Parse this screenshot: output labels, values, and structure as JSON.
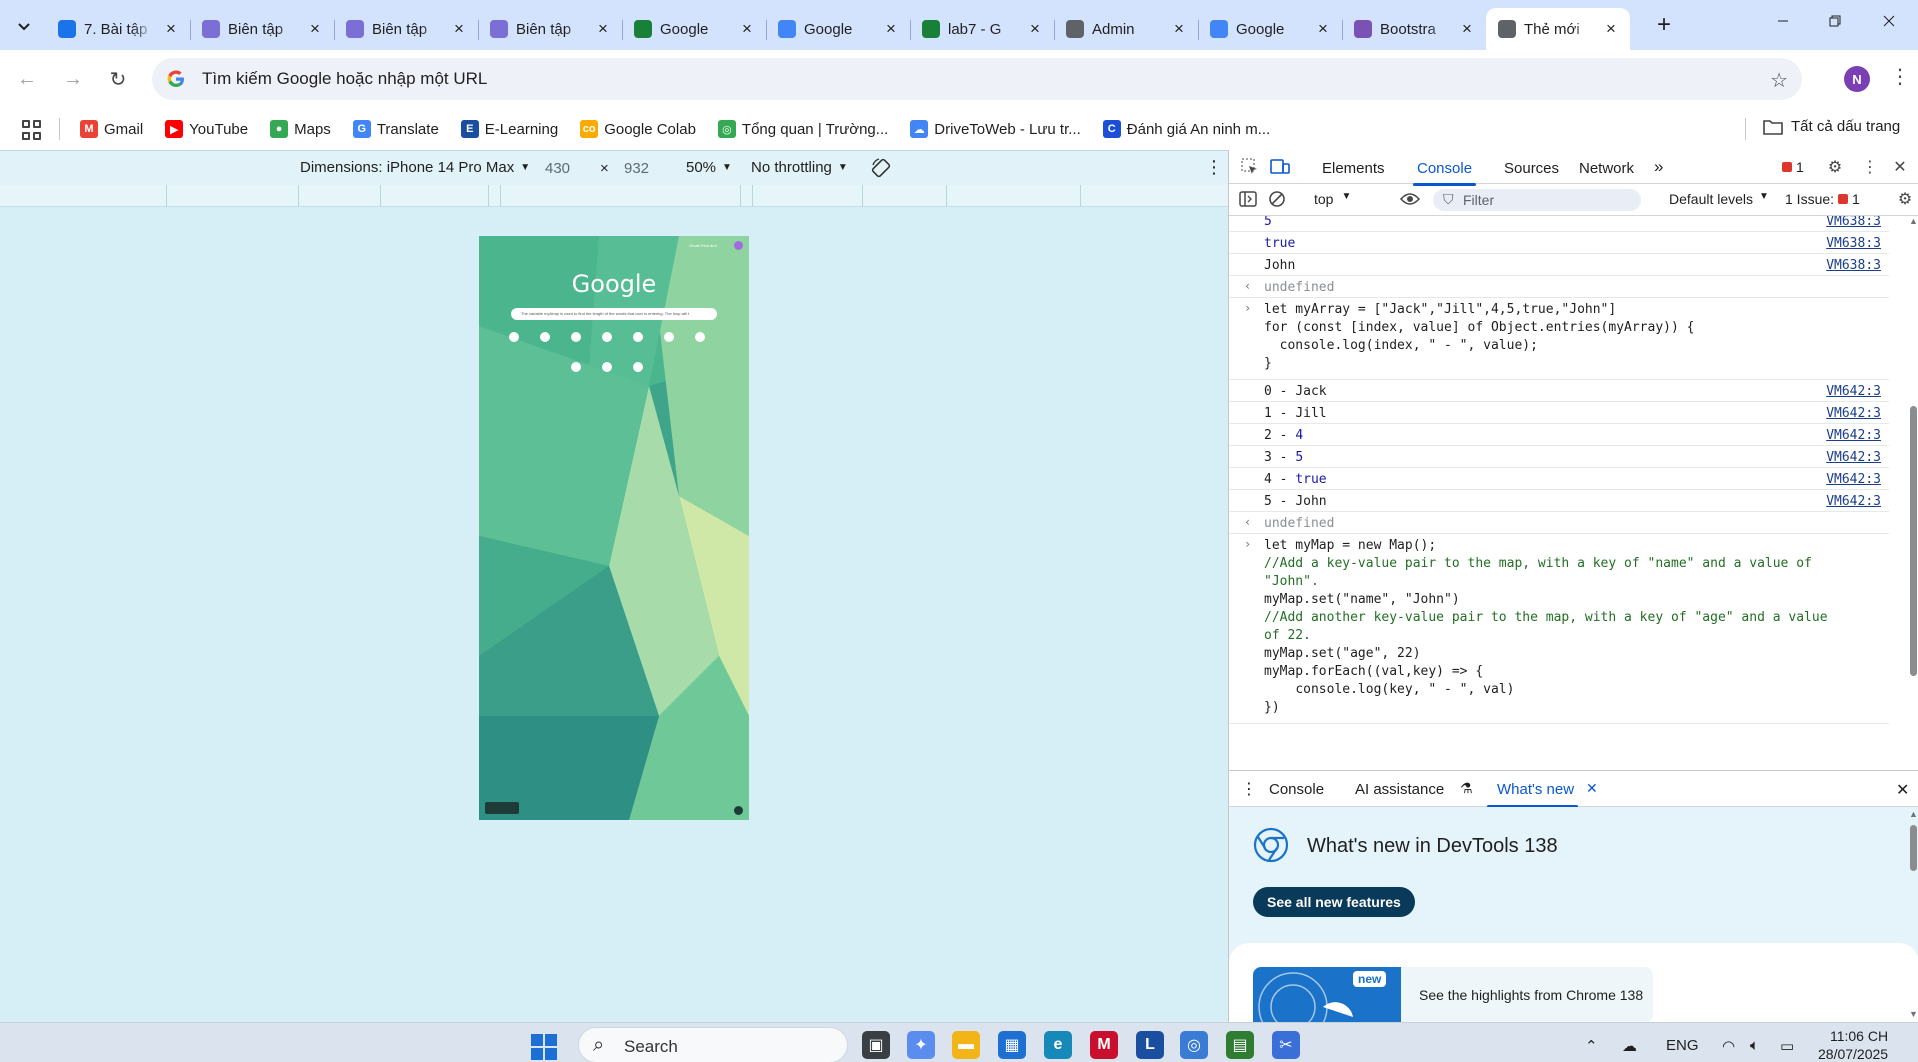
{
  "colors": {
    "tabstrip": "#d3e3fd",
    "accent": "#0b57d0",
    "devtools_bg": "#ffffff",
    "viewport_bg": "#d6eef5",
    "error": "#dc362e"
  },
  "tabs": [
    {
      "title": "7. Bài tập",
      "icon": "classroom-icon",
      "color": "#1a73e8"
    },
    {
      "title": "Biên tập",
      "icon": "editor-icon",
      "color": "#7b6fd6"
    },
    {
      "title": "Biên tập",
      "icon": "editor-icon",
      "color": "#7b6fd6"
    },
    {
      "title": "Biên tập",
      "icon": "editor-icon",
      "color": "#7b6fd6"
    },
    {
      "title": "Google",
      "icon": "google-sheets-icon",
      "color": "#188038"
    },
    {
      "title": "Google",
      "icon": "gemini-icon",
      "color": "#4285f4"
    },
    {
      "title": "lab7 - G",
      "icon": "google-drive-icon",
      "color": "#188038"
    },
    {
      "title": "Admin",
      "icon": "cloud-icon",
      "color": "#5f6368"
    },
    {
      "title": "Google",
      "icon": "google-translate-icon",
      "color": "#4285f4"
    },
    {
      "title": "Bootstra",
      "icon": "bootstrap-icon",
      "color": "#7952b3"
    },
    {
      "title": "Thẻ mới",
      "icon": "chrome-icon",
      "color": "#5f6368",
      "active": true
    }
  ],
  "omnibox": {
    "placeholder": "Tìm kiếm Google hoặc nhập một URL",
    "avatar": "N"
  },
  "bookmarks": [
    {
      "label": "Gmail",
      "icon": "gmail-icon",
      "color": "#ea4335",
      "glyph": "M"
    },
    {
      "label": "YouTube",
      "icon": "youtube-icon",
      "color": "#ff0000",
      "glyph": "▶"
    },
    {
      "label": "Maps",
      "icon": "maps-icon",
      "color": "#34a853",
      "glyph": "●"
    },
    {
      "label": "Translate",
      "icon": "translate-icon",
      "color": "#4285f4",
      "glyph": "G"
    },
    {
      "label": "E-Learning",
      "icon": "elearning-icon",
      "color": "#1a4fa0",
      "glyph": "E"
    },
    {
      "label": "Google Colab",
      "icon": "colab-icon",
      "color": "#f9ab00",
      "glyph": "co"
    },
    {
      "label": "Tổng quan | Trường...",
      "icon": "chrome-icon",
      "color": "#34a853",
      "glyph": "◎"
    },
    {
      "label": "DriveToWeb - Lưu tr...",
      "icon": "cloud-icon",
      "color": "#4285f4",
      "glyph": "☁"
    },
    {
      "label": "Đánh giá An ninh m...",
      "icon": "c-icon",
      "color": "#1a4fd6",
      "glyph": "C"
    }
  ],
  "bookmarks_all": "Tất cả dấu trang",
  "device_toolbar": {
    "dimensions": "Dimensions: iPhone 14 Pro Max",
    "width": "430",
    "times": "×",
    "height": "932",
    "zoom": "50%",
    "throttling": "No throttling"
  },
  "phone": {
    "logo": "Google",
    "search_text": "The variable myArray is used to find the length of the words that user is entering. The loop will t",
    "shortcuts_row1": 7,
    "shortcuts_row2": 3
  },
  "devtools": {
    "tabs": [
      "Elements",
      "Console",
      "Sources",
      "Network"
    ],
    "active_tab": "Console",
    "error_count": "1",
    "context": "top",
    "filter_placeholder": "Filter",
    "levels": "Default levels",
    "issues": "1 Issue:",
    "issues_count": "1"
  },
  "console": {
    "log_a": [
      {
        "value": "5",
        "type": "num",
        "src": "VM638:3"
      },
      {
        "value": "true",
        "type": "num",
        "src": "VM638:3"
      },
      {
        "value": "John",
        "type": "str",
        "src": "VM638:3"
      }
    ],
    "undefined": "undefined",
    "cmd1": [
      "let myArray = [\"Jack\",\"Jill\",4,5,true,\"John\"]",
      "for (const [index, value] of Object.entries(myArray)) {",
      "  console.log(index, \" - \", value);",
      "}"
    ],
    "log_b": [
      {
        "index": "0",
        "sep": " - ",
        "value": "Jack",
        "type": "str",
        "src": "VM642:3"
      },
      {
        "index": "1",
        "sep": " - ",
        "value": "Jill",
        "type": "str",
        "src": "VM642:3"
      },
      {
        "index": "2",
        "sep": " - ",
        "value": "4",
        "type": "num",
        "src": "VM642:3"
      },
      {
        "index": "3",
        "sep": " - ",
        "value": "5",
        "type": "num",
        "src": "VM642:3"
      },
      {
        "index": "4",
        "sep": " - ",
        "value": "true",
        "type": "num",
        "src": "VM642:3"
      },
      {
        "index": "5",
        "sep": " - ",
        "value": "John",
        "type": "str",
        "src": "VM642:3"
      }
    ],
    "cmd2": [
      "let myMap = new Map();",
      "//Add a key-value pair to the map, with a key of \"name\" and a value of",
      "\"John\".",
      "myMap.set(\"name\", \"John\")",
      "//Add another key-value pair to the map, with a key of \"age\" and a value",
      "of 22.",
      "myMap.set(\"age\", 22)",
      "myMap.forEach((val,key) => {",
      "    console.log(key, \" - \", val)",
      "})"
    ]
  },
  "drawer": {
    "tabs": [
      "Console",
      "AI assistance",
      "What's new"
    ],
    "active_tab": "What's new",
    "title": "What's new in DevTools 138",
    "button": "See all new features",
    "badge": "new",
    "highlight": "See the highlights from Chrome 138"
  },
  "taskbar": {
    "search": "Search",
    "lang": "ENG",
    "time": "11:06 CH",
    "date": "28/07/2025",
    "apps": [
      {
        "icon": "task-view-icon",
        "color": "#3a3f44",
        "glyph": "▣"
      },
      {
        "icon": "copilot-icon",
        "color": "#5b8def",
        "glyph": "✦"
      },
      {
        "icon": "file-explorer-icon",
        "color": "#f2b416",
        "glyph": "▬"
      },
      {
        "icon": "store-icon",
        "color": "#1d6fd1",
        "glyph": "▦"
      },
      {
        "icon": "edge-icon",
        "color": "#1789b9",
        "glyph": "e"
      },
      {
        "icon": "mcafee-icon",
        "color": "#c8102e",
        "glyph": "M"
      },
      {
        "icon": "l-app-icon",
        "color": "#1a4fa0",
        "glyph": "L"
      },
      {
        "icon": "chrome-icon",
        "color": "#3a7bd5",
        "glyph": "◎"
      },
      {
        "icon": "excel-chart-icon",
        "color": "#2e7d32",
        "glyph": "▤"
      },
      {
        "icon": "snipping-tool-icon",
        "color": "#3a6fd8",
        "glyph": "✂"
      }
    ]
  }
}
